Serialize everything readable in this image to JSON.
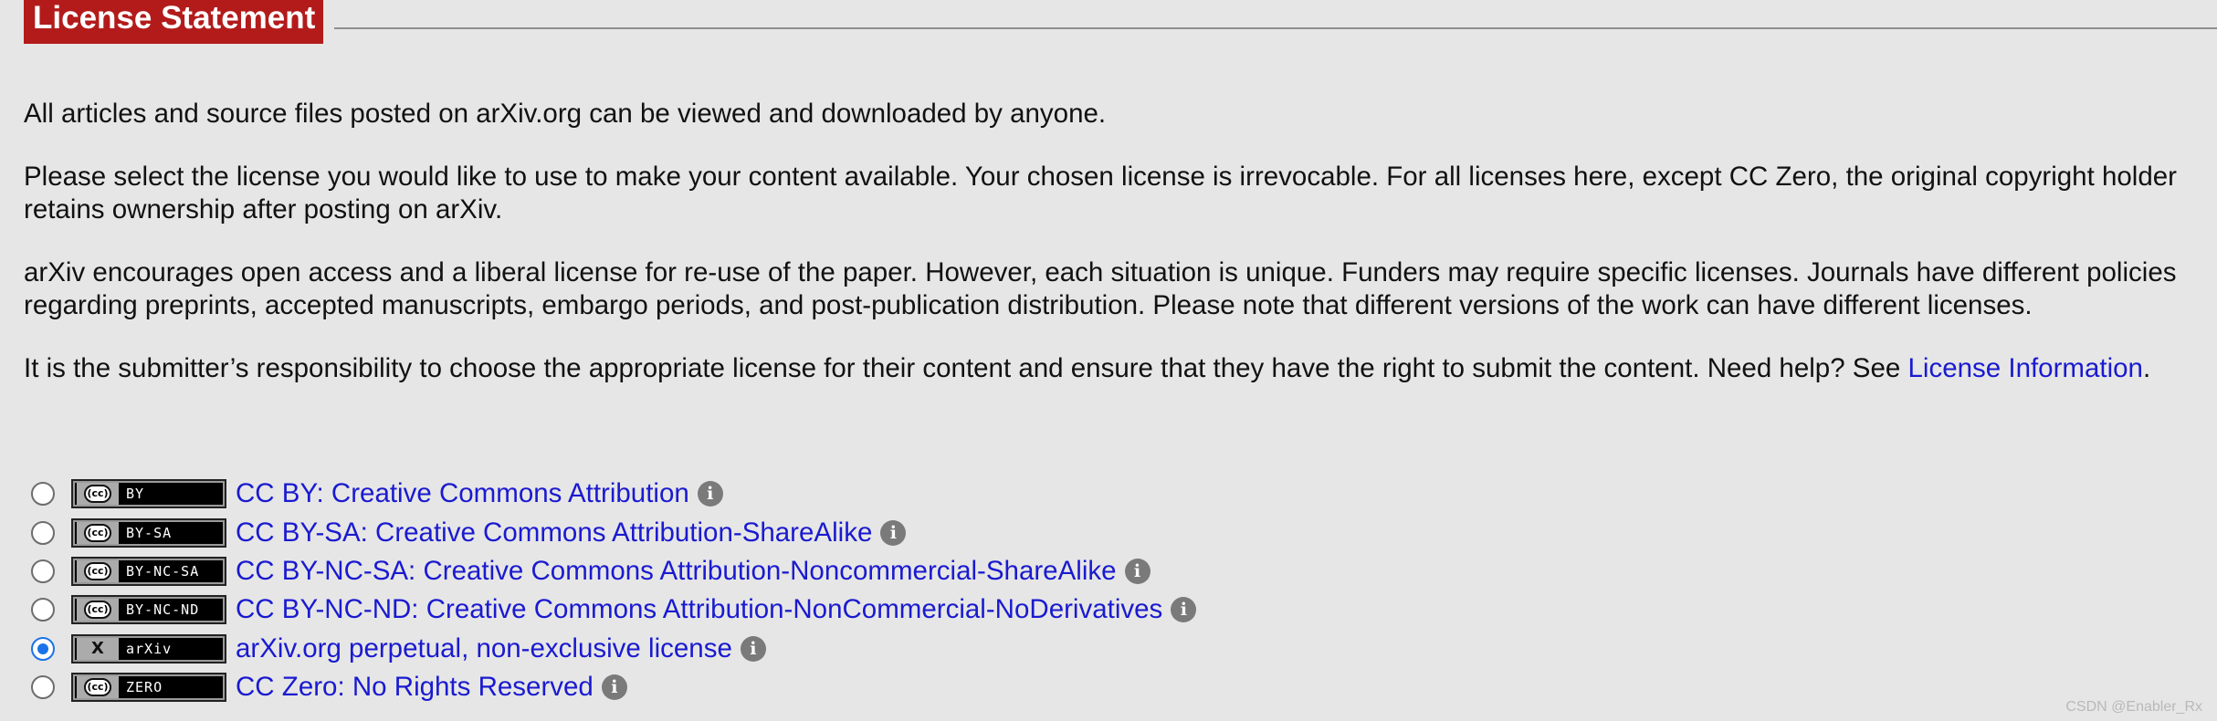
{
  "heading": {
    "title": "License Statement"
  },
  "paragraphs": {
    "p1": "All articles and source files posted on arXiv.org can be viewed and downloaded by anyone.",
    "p2": "Please select the license you would like to use to make your content available. Your chosen license is irrevocable. For all licenses here, except CC Zero, the original copyright holder retains ownership after posting on arXiv.",
    "p3": "arXiv encourages open access and a liberal license for re-use of the paper. However, each situation is unique. Funders may require specific licenses. Journals have different policies regarding preprints, accepted manuscripts, embargo periods, and post-publication distribution. Please note that different versions of the work can have different licenses.",
    "p4_prefix": "It is the submitter’s responsibility to choose the appropriate license for their content and ensure that they have the right to submit the content. Need help? See ",
    "p4_link": "License Information",
    "p4_suffix": "."
  },
  "licenses": [
    {
      "badge_logo": "cc",
      "badge_text": "BY",
      "label": "CC BY: Creative Commons Attribution",
      "checked": false
    },
    {
      "badge_logo": "cc",
      "badge_text": "BY-SA",
      "label": "CC BY-SA: Creative Commons Attribution-ShareAlike",
      "checked": false
    },
    {
      "badge_logo": "cc",
      "badge_text": "BY-NC-SA",
      "label": "CC BY-NC-SA: Creative Commons Attribution-Noncommercial-ShareAlike",
      "checked": false
    },
    {
      "badge_logo": "cc",
      "badge_text": "BY-NC-ND",
      "label": "CC BY-NC-ND: Creative Commons Attribution-NonCommercial-NoDerivatives",
      "checked": false
    },
    {
      "badge_logo": "x",
      "badge_text": "arXiv",
      "label": "arXiv.org perpetual, non-exclusive license",
      "checked": true
    },
    {
      "badge_logo": "cc",
      "badge_text": "ZERO",
      "label": "CC Zero: No Rights Reserved",
      "checked": false
    }
  ],
  "badge_glyphs": {
    "cc": "(cc)",
    "x": "X"
  },
  "info_glyph": "i",
  "colors": {
    "heading_bg": "#b31b1b",
    "link": "#1a1ad0",
    "background": "#e6e6e6",
    "radio_checked": "#1a73e8"
  },
  "watermark": "CSDN @Enabler_Rx"
}
